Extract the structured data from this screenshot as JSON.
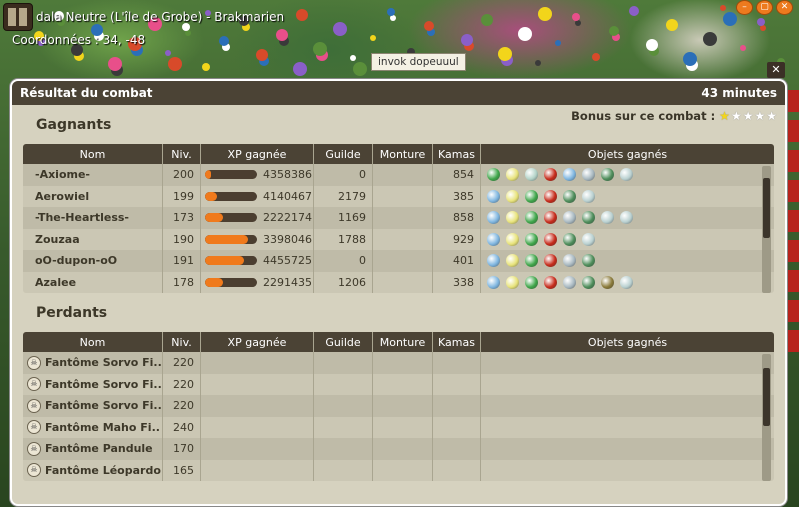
{
  "hud": {
    "zone": "dala Neutre (L'île de Grobe) - Brakmarien",
    "coords": "Coordonnées : 34, -48",
    "tooltip": "invok dopeuuul"
  },
  "panel": {
    "title": "Résultat du combat",
    "duration": "43 minutes",
    "bonus_label": "Bonus sur ce combat :",
    "bonus_stars": 1,
    "bonus_max": 5
  },
  "columns": [
    "Nom",
    "Niv.",
    "XP gagnée",
    "Guilde",
    "Monture",
    "Kamas",
    "Objets gagnés"
  ],
  "winners": {
    "title": "Gagnants",
    "rows": [
      {
        "name": "-Axiome-",
        "level": "200",
        "xp": "4358386",
        "xp_fill": 0.12,
        "guild": "0",
        "mount": "",
        "kamas": "854",
        "objects": [
          "#3fa64a",
          "#e8e37a",
          "#b3d3c8",
          "#c62a1a",
          "#7fb6e0",
          "#a8b8c0",
          "#4d8d5a",
          "#b9d0d0"
        ]
      },
      {
        "name": "Aerowiel",
        "level": "199",
        "xp": "4140467",
        "xp_fill": 0.24,
        "guild": "2179",
        "mount": "",
        "kamas": "385",
        "objects": [
          "#7fb6e0",
          "#e8e37a",
          "#3fa64a",
          "#c62a1a",
          "#4d8d5a",
          "#b9d0d0"
        ]
      },
      {
        "name": "-The-Heartless-",
        "level": "173",
        "xp": "2222174",
        "xp_fill": 0.35,
        "guild": "1169",
        "mount": "",
        "kamas": "858",
        "objects": [
          "#7fb6e0",
          "#e8e37a",
          "#3fa64a",
          "#c62a1a",
          "#a8b8c0",
          "#4d8d5a",
          "#b9d0d0",
          "#b9d0d0"
        ]
      },
      {
        "name": "Zouzaa",
        "level": "190",
        "xp": "3398046",
        "xp_fill": 0.82,
        "guild": "1788",
        "mount": "",
        "kamas": "929",
        "objects": [
          "#7fb6e0",
          "#e8e37a",
          "#3fa64a",
          "#c62a1a",
          "#4d8d5a",
          "#b9d0d0"
        ]
      },
      {
        "name": "oO-dupon-oO",
        "level": "191",
        "xp": "4455725",
        "xp_fill": 0.75,
        "guild": "0",
        "mount": "",
        "kamas": "401",
        "objects": [
          "#7fb6e0",
          "#e8e37a",
          "#3fa64a",
          "#c62a1a",
          "#a8b8c0",
          "#4d8d5a"
        ]
      },
      {
        "name": "Azalee",
        "level": "178",
        "xp": "2291435",
        "xp_fill": 0.35,
        "guild": "1206",
        "mount": "",
        "kamas": "338",
        "objects": [
          "#7fb6e0",
          "#e8e37a",
          "#3fa64a",
          "#c62a1a",
          "#a8b8c0",
          "#4d8d5a",
          "#8a7a3a",
          "#b9d0d0"
        ]
      }
    ]
  },
  "losers": {
    "title": "Perdants",
    "rows": [
      {
        "name": "Fantôme Sorvo Fi..",
        "level": "220"
      },
      {
        "name": "Fantôme Sorvo Fi..",
        "level": "220"
      },
      {
        "name": "Fantôme Sorvo Fi..",
        "level": "220"
      },
      {
        "name": "Fantôme Maho Fi..",
        "level": "240"
      },
      {
        "name": "Fantôme Pandule",
        "level": "170"
      },
      {
        "name": "Fantôme Léopardo",
        "level": "165"
      }
    ]
  },
  "colors": {
    "accent": "#f07a1c",
    "header": "#4b4335",
    "panel": "#d6d2bf",
    "star_on": "#f2d51b",
    "star_off": "#ffffff"
  }
}
